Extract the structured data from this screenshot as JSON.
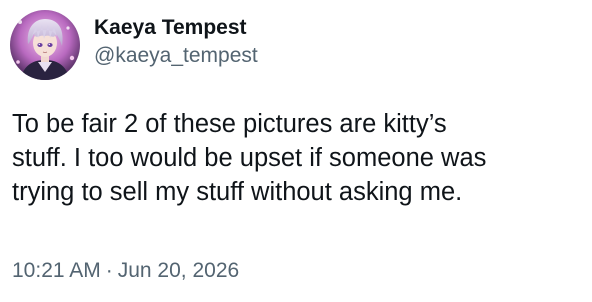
{
  "author": {
    "display_name": "Kaeya Tempest",
    "handle": "@kaeya_tempest",
    "avatar_icon": "anime-character-avatar"
  },
  "tweet": {
    "text": "To be fair 2 of these pictures are kitty’s\nstuff. I too would be upset if someone was\ntrying to sell my stuff without asking me.",
    "time": "10:21 AM",
    "separator": "·",
    "date": "Jun 20, 2026"
  },
  "colors": {
    "text_primary": "#0f1419",
    "text_secondary": "#536471",
    "background": "#ffffff"
  }
}
